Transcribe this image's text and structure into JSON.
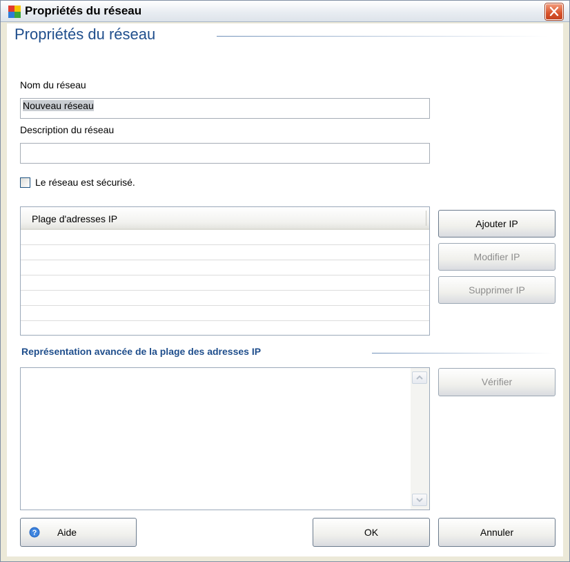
{
  "window": {
    "title": "Propriétés du réseau"
  },
  "dialog": {
    "heading": "Propriétés du réseau",
    "network_name_label": "Nom du réseau",
    "network_name_value": "Nouveau réseau",
    "network_description_label": "Description du réseau",
    "network_description_value": "",
    "secure_checkbox_label": "Le réseau est sécurisé.",
    "secure_checked": false
  },
  "ip_list": {
    "column_header": "Plage d'adresses IP",
    "rows": []
  },
  "ip_buttons": {
    "add": "Ajouter IP",
    "modify": "Modifier IP",
    "delete": "Supprimer IP"
  },
  "advanced": {
    "section_title": "Représentation avancée de la plage des adresses IP",
    "text_value": "",
    "verify_button": "Vérifier"
  },
  "footer": {
    "help_button": "Aide",
    "ok_button": "OK",
    "cancel_button": "Annuler"
  },
  "colors": {
    "heading_blue": "#1f4e8c",
    "close_red": "#d8532b"
  },
  "icons": {
    "app": "avg-logo-icon",
    "close": "close-icon",
    "help": "help-icon",
    "scroll_up": "chevron-up-icon",
    "scroll_down": "chevron-down-icon"
  }
}
